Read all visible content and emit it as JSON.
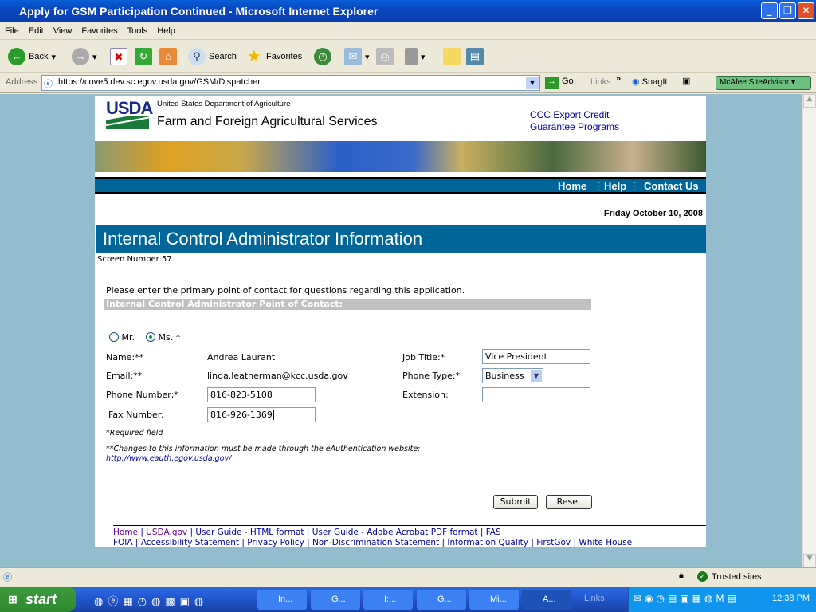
{
  "window": {
    "title": "Apply for GSM Participation Continued - Microsoft Internet Explorer"
  },
  "menu": [
    "File",
    "Edit",
    "View",
    "Favorites",
    "Tools",
    "Help"
  ],
  "toolbar": {
    "back": "Back",
    "search": "Search",
    "favorites": "Favorites"
  },
  "address": {
    "label": "Address",
    "url": "https://cove5.dev.sc.egov.usda.gov/GSM/Dispatcher",
    "go": "Go",
    "links": "Links",
    "snagit": "SnagIt",
    "mcafee": "McAfee SiteAdvisor"
  },
  "header": {
    "logo": "USDA",
    "dept": "United States Department of Agriculture",
    "agency": "Farm and Foreign Agricultural Services",
    "program_line1": "CCC Export Credit",
    "program_line2": "Guarantee Programs"
  },
  "nav": [
    "Home",
    "Help",
    "Contact Us"
  ],
  "date": "Friday October 10, 2008",
  "page_title": "Internal Control Administrator Information",
  "screen_number": "Screen Number 57",
  "instructions": "Please enter the primary point of contact for questions regarding this application.",
  "section_title": "Internal Control Administrator Point of Contact:",
  "form": {
    "salutation": {
      "mr": "Mr.",
      "ms": "Ms. *",
      "selected": "ms"
    },
    "name_label": "Name:**",
    "name_value": "Andrea Laurant",
    "email_label": "Email:**",
    "email_value": "linda.leatherman@kcc.usda.gov",
    "phone_label": "Phone Number:*",
    "phone_value": "816-823-5108",
    "fax_label": "Fax Number:",
    "fax_value": "816-926-1369",
    "job_title_label": "Job Title:*",
    "job_title_value": "Vice President",
    "phone_type_label": "Phone Type:*",
    "phone_type_value": "Business",
    "extension_label": "Extension:",
    "extension_value": "",
    "required_note": "*Required field",
    "changes_note": "**Changes to this information must be made through the eAuthentication website:",
    "eauth_link": "http://www.eauth.egov.usda.gov/",
    "submit": "Submit",
    "reset": "Reset"
  },
  "footer": {
    "row1": [
      "Home",
      "USDA.gov",
      "User Guide - HTML format",
      "User Guide - Adobe Acrobat PDF format",
      "FAS"
    ],
    "row2": [
      "FOIA",
      "Accessibility Statement",
      "Privacy Policy",
      "Non-Discrimination Statement",
      "Information Quality",
      "FirstGov",
      "White House"
    ]
  },
  "status": {
    "zone": "Trusted sites"
  },
  "taskbar": {
    "start": "start",
    "tasks": [
      "In...",
      "G...",
      "I:...",
      "G...",
      "Mi...",
      "A..."
    ],
    "links": "Links",
    "clock": "12:38 PM"
  }
}
